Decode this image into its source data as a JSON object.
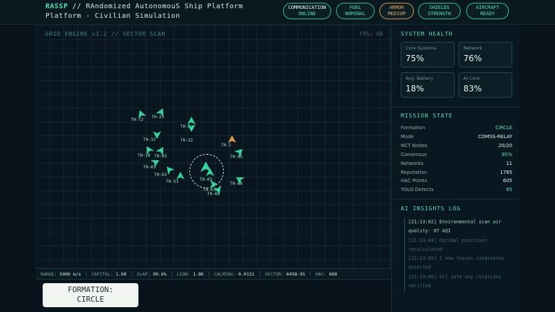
{
  "header": {
    "brand": "RASSP",
    "title_line1_rest": " // RAndomized AutonomouS Ship Platform",
    "title_line2": "Platform - Civilian Simulation",
    "status": [
      {
        "l1": "COMMUNICATION",
        "l2": "ONLINE",
        "state": "active"
      },
      {
        "l1": "FUEL",
        "l2": "NOMINAL",
        "state": "ok"
      },
      {
        "l1": "ARMOR",
        "l2": "MEDIUM",
        "state": "warn"
      },
      {
        "l1": "SHIELDS",
        "l2": "STRENGTH",
        "state": "ok"
      },
      {
        "l1": "AIRCRAFT",
        "l2": "READY",
        "state": "ok"
      }
    ]
  },
  "grid": {
    "label": "GRID ENGINE v1.2 // SECTOR SCAN",
    "fps": "FPS: 60",
    "units": [
      {
        "tag": "TH-72"
      },
      {
        "tag": "TH-23"
      },
      {
        "tag": "TH-32"
      },
      {
        "tag": "TH-32"
      },
      {
        "tag": "TH-32"
      },
      {
        "tag": "TH-18"
      },
      {
        "tag": "TH-03"
      },
      {
        "tag": "TH-03"
      },
      {
        "tag": "TH-63"
      },
      {
        "tag": "TH-53"
      },
      {
        "tag": "TH-03"
      },
      {
        "tag": "TH-03"
      },
      {
        "tag": "TH-06"
      },
      {
        "tag": "TH-2"
      },
      {
        "tag": "TH-95"
      },
      {
        "tag": "TH-63"
      }
    ]
  },
  "stats": [
    {
      "k": "RANGE:",
      "v": "5000 m/s"
    },
    {
      "k": "CAPITAL:",
      "v": "1.08"
    },
    {
      "k": "SLAP:",
      "v": "99.6%"
    },
    {
      "k": "LION:",
      "v": "1.8K"
    },
    {
      "k": "CALMING:",
      "v": "0.0131"
    },
    {
      "k": "VECTOR:",
      "v": "6458-91"
    },
    {
      "k": "HAC:",
      "v": "608"
    }
  ],
  "formation_button": {
    "line1": "FORMATION:",
    "line2": "CIRCLE"
  },
  "system_health": {
    "title": "SYSTEM HEALTH",
    "cards": [
      {
        "label": "Core Systems",
        "value": "75%"
      },
      {
        "label": "Network",
        "value": "76%"
      },
      {
        "label": "Avg. Battery",
        "value": "18%"
      },
      {
        "label": "AI Core",
        "value": "83%"
      }
    ]
  },
  "mission_state": {
    "title": "MISSION STATE",
    "rows": [
      {
        "k": "Formation",
        "v": "CIRCLE",
        "accent": true
      },
      {
        "k": "Mode",
        "v": "COMSS-RELAY",
        "accent": false
      },
      {
        "k": "NCT Nodes",
        "v": "20/20",
        "accent": false
      },
      {
        "k": "Consensus",
        "v": "95%",
        "accent": true
      },
      {
        "k": "Networks",
        "v": "11",
        "accent": false
      },
      {
        "k": "Reputation",
        "v": "1765",
        "accent": false
      },
      {
        "k": "HAC Points",
        "v": "605",
        "accent": false
      },
      {
        "k": "YOLO Detects",
        "v": "65",
        "accent": true
      }
    ]
  },
  "insights": {
    "title": "AI INSIGHTS LOG",
    "entries": [
      {
        "text": "[21:13:02] Environmental scan air quality: 87 AQI",
        "level": "hi"
      },
      {
        "text": "[21:13:04] Optimal positions recalculated",
        "level": "lo"
      },
      {
        "text": "[21:13:05] 2 new fusion candidates detected",
        "level": "lo"
      },
      {
        "text": "[21:13:06] All safe key rotations verified",
        "level": "lo"
      }
    ]
  },
  "colors": {
    "accent": "#48e6b4",
    "warn": "#e3a766",
    "unit": "#2fd79d",
    "unit_alt": "#e39a4a"
  }
}
